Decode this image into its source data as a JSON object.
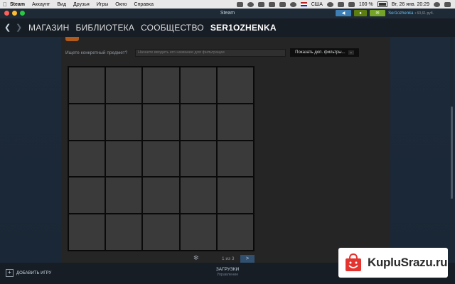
{
  "menubar": {
    "app": "Steam",
    "items": [
      "Аккаунт",
      "Вид",
      "Друзья",
      "Игры",
      "Окно",
      "Справка"
    ],
    "input_lang": "США",
    "battery": "100 %",
    "clock": "Вт, 26 янв.  20:29"
  },
  "window": {
    "title": "Steam",
    "user_name": "Ser1ozhenka",
    "user_balance": "• 60,61 руб."
  },
  "nav": {
    "links": [
      "МАГАЗИН",
      "БИБЛИОТЕКА",
      "СООБЩЕСТВО",
      "SER1OZHENKA"
    ]
  },
  "inventory": {
    "search_label": "Ищете конкретный предмет?",
    "search_placeholder": "Начните вводить его название для фильтрации",
    "filters_button": "Показать доп. фильтры...",
    "filters_chevron": "⌄",
    "page_info": "1 из 3",
    "next_label": ">"
  },
  "bottom": {
    "add_game": "ДОБАВИТЬ ИГРУ",
    "downloads_title": "ЗАГРУЗКИ",
    "downloads_sub": "Управление"
  },
  "watermark": {
    "text": "KupluSrazu.ru"
  }
}
